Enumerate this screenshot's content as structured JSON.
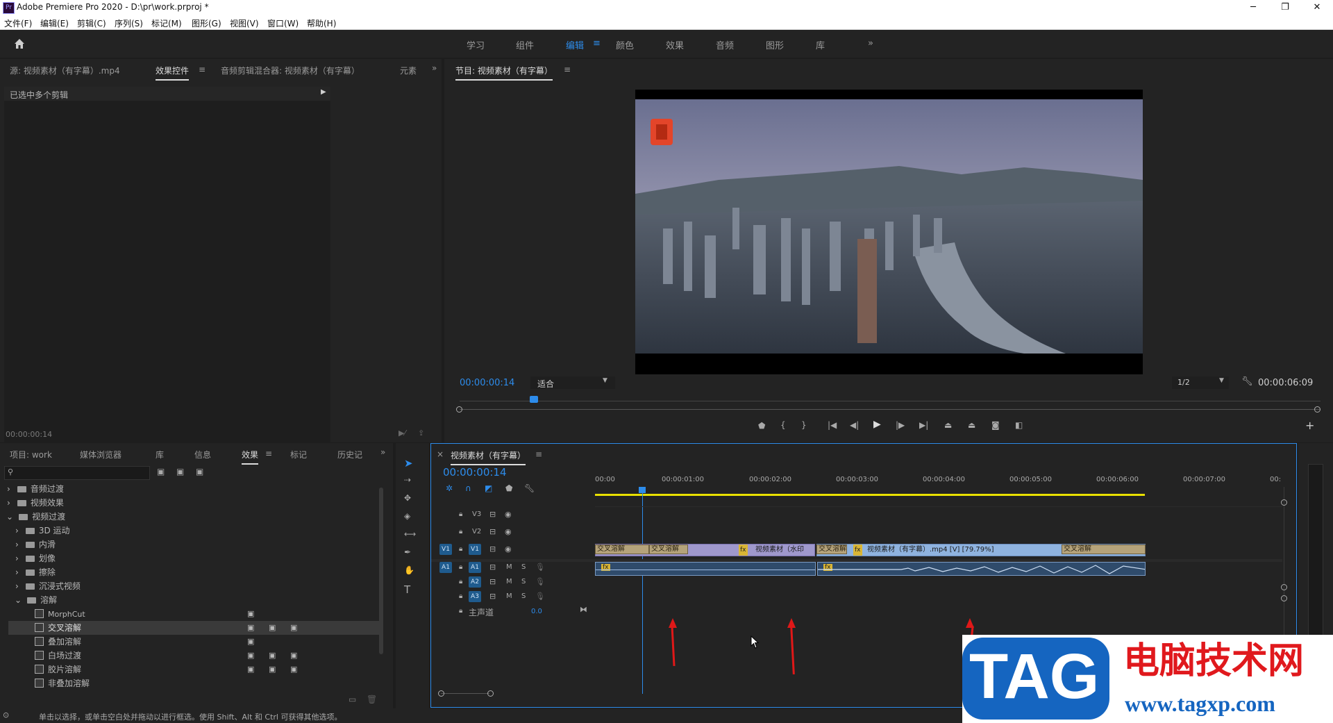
{
  "window": {
    "title": "Adobe Premiere Pro 2020 - D:\\pr\\work.prproj *",
    "logo_text": "Pr",
    "minimize_glyph": "─",
    "restore_glyph": "❐",
    "close_glyph": "✕"
  },
  "menu": [
    "文件(F)",
    "编辑(E)",
    "剪辑(C)",
    "序列(S)",
    "标记(M)",
    "图形(G)",
    "视图(V)",
    "窗口(W)",
    "帮助(H)"
  ],
  "workspaces": {
    "items": [
      "学习",
      "组件",
      "编辑",
      "颜色",
      "效果",
      "音频",
      "图形",
      "库"
    ],
    "active": "编辑",
    "more": "»"
  },
  "source_panel": {
    "tabs": [
      "源: 视频素材（有字幕）.mp4",
      "效果控件",
      "音频剪辑混合器: 视频素材（有字幕）",
      "元素"
    ],
    "active_tab": "效果控件",
    "overflow": "»",
    "selection_text": "已选中多个剪辑",
    "timecode": "00:00:00:14"
  },
  "program_monitor": {
    "title": "节目: 视频素材（有字幕）",
    "timecode": "00:00:00:14",
    "fit": "适合",
    "resolution": "1/2",
    "duration": "00:00:06:09",
    "add_glyph": "+"
  },
  "project_panel": {
    "tabs": [
      "项目: work",
      "媒体浏览器",
      "库",
      "信息",
      "效果",
      "标记",
      "历史记"
    ],
    "active_tab": "效果",
    "overflow": "»",
    "search_placeholder": "",
    "tree": [
      {
        "label": "音频过渡",
        "level": 0,
        "expanded": false
      },
      {
        "label": "视频效果",
        "level": 0,
        "expanded": false
      },
      {
        "label": "视频过渡",
        "level": 0,
        "expanded": true
      },
      {
        "label": "3D 运动",
        "level": 1,
        "expanded": false
      },
      {
        "label": "内滑",
        "level": 1,
        "expanded": false
      },
      {
        "label": "划像",
        "level": 1,
        "expanded": false
      },
      {
        "label": "擦除",
        "level": 1,
        "expanded": false
      },
      {
        "label": "沉浸式视频",
        "level": 1,
        "expanded": false
      },
      {
        "label": "溶解",
        "level": 1,
        "expanded": true
      }
    ],
    "effects": [
      {
        "label": "MorphCut",
        "badges": 1,
        "selected": false
      },
      {
        "label": "交叉溶解",
        "badges": 3,
        "selected": true
      },
      {
        "label": "叠加溶解",
        "badges": 1,
        "selected": false
      },
      {
        "label": "白场过渡",
        "badges": 3,
        "selected": false
      },
      {
        "label": "胶片溶解",
        "badges": 3,
        "selected": false
      },
      {
        "label": "非叠加溶解",
        "badges": 0,
        "selected": false
      }
    ]
  },
  "timeline": {
    "sequence_name": "视频素材（有字幕）",
    "timecode": "00:00:00:14",
    "ruler": [
      "00:00",
      "00:00:01:00",
      "00:00:02:00",
      "00:00:03:00",
      "00:00:04:00",
      "00:00:05:00",
      "00:00:06:00",
      "00:00:07:00",
      "00:"
    ],
    "video_tracks": [
      {
        "name": "V3"
      },
      {
        "name": "V2"
      },
      {
        "name": "V1",
        "source": "V1"
      }
    ],
    "audio_tracks": [
      {
        "name": "A1",
        "source": "A1"
      },
      {
        "name": "A2"
      },
      {
        "name": "A3"
      }
    ],
    "mute_label": "M",
    "solo_label": "S",
    "master_label": "主声道",
    "master_value": "0.0",
    "transition_label": "交叉溶解",
    "clip_label_1": "视频素材（水印",
    "clip_label_2": "视频素材（有字幕）.mp4 [V] [79.79%]",
    "fx_badge": "fx"
  },
  "status_bar": "单击以选择，或单击空白处并拖动以进行框选。使用 Shift、Alt 和 Ctrl 可获得其他选项。",
  "watermark": {
    "tag": "TAG",
    "cn": "电脑技术网",
    "url": "www.tagxp.com"
  }
}
